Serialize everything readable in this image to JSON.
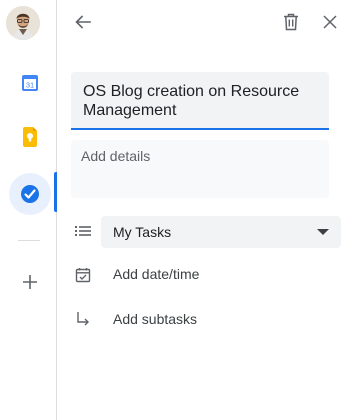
{
  "colors": {
    "accent": "#1a73e8",
    "calendar_blue": "#4285f4",
    "keep_yellow": "#fbbc04"
  },
  "rail": {
    "calendar_icon_text": "31",
    "icons": [
      "avatar",
      "calendar-icon",
      "keep-icon",
      "tasks-icon",
      "add-icon"
    ]
  },
  "task": {
    "title": "OS Blog creation on Resource Management",
    "details_placeholder": "Add details",
    "list_value": "My Tasks",
    "date_label": "Add date/time",
    "subtasks_label": "Add subtasks"
  }
}
